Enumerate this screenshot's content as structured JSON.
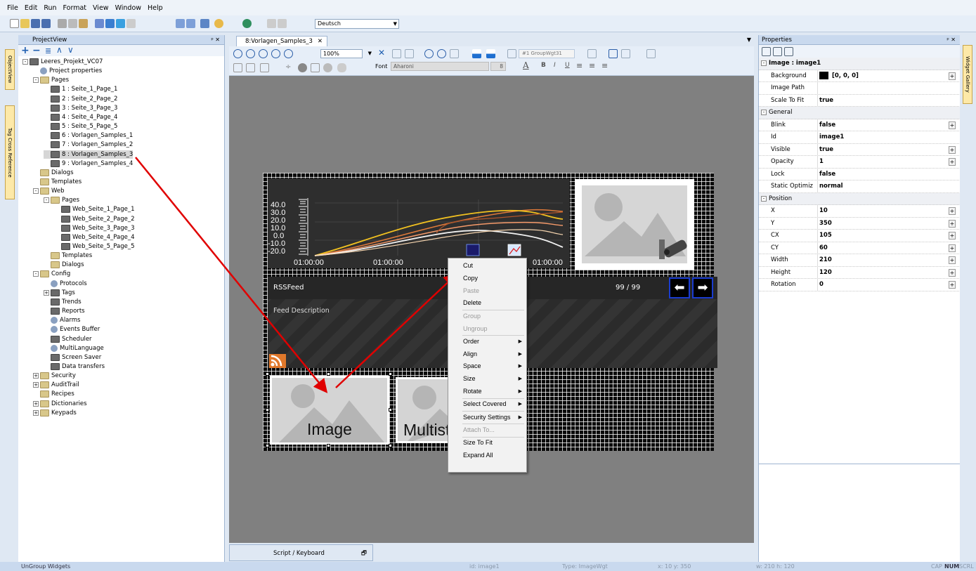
{
  "menu": [
    "File",
    "Edit",
    "Run",
    "Format",
    "View",
    "Window",
    "Help"
  ],
  "toolbar": {
    "language": "Deutsch"
  },
  "project_view": {
    "title": "ProjectView",
    "side_tabs": [
      "ObjectView",
      "Tag Cross Reference"
    ],
    "tree": [
      {
        "label": "Leeres_Projekt_VC07",
        "indent": 0,
        "expander": "-",
        "icon": "project"
      },
      {
        "label": "Project properties",
        "indent": 1,
        "expander": "",
        "icon": "gear"
      },
      {
        "label": "Pages",
        "indent": 1,
        "expander": "-",
        "icon": "folder"
      },
      {
        "label": "1 : Seite_1_Page_1",
        "indent": 2,
        "expander": "",
        "icon": "page"
      },
      {
        "label": "2 : Seite_2_Page_2",
        "indent": 2,
        "expander": "",
        "icon": "page"
      },
      {
        "label": "3 : Seite_3_Page_3",
        "indent": 2,
        "expander": "",
        "icon": "page"
      },
      {
        "label": "4 : Seite_4_Page_4",
        "indent": 2,
        "expander": "",
        "icon": "page"
      },
      {
        "label": "5 : Seite_5_Page_5",
        "indent": 2,
        "expander": "",
        "icon": "page"
      },
      {
        "label": "6 : Vorlagen_Samples_1",
        "indent": 2,
        "expander": "",
        "icon": "page"
      },
      {
        "label": "7 : Vorlagen_Samples_2",
        "indent": 2,
        "expander": "",
        "icon": "page"
      },
      {
        "label": "8 : Vorlagen_Samples_3",
        "indent": 2,
        "expander": "",
        "icon": "page",
        "selected": true
      },
      {
        "label": "9 : Vorlagen_Samples_4",
        "indent": 2,
        "expander": "",
        "icon": "page"
      },
      {
        "label": "Dialogs",
        "indent": 1,
        "expander": "",
        "icon": "folder"
      },
      {
        "label": "Templates",
        "indent": 1,
        "expander": "",
        "icon": "folder"
      },
      {
        "label": "Web",
        "indent": 1,
        "expander": "-",
        "icon": "folder"
      },
      {
        "label": "Pages",
        "indent": 2,
        "expander": "-",
        "icon": "folder"
      },
      {
        "label": "Web_Seite_1_Page_1",
        "indent": 3,
        "expander": "",
        "icon": "page"
      },
      {
        "label": "Web_Seite_2_Page_2",
        "indent": 3,
        "expander": "",
        "icon": "page"
      },
      {
        "label": "Web_Seite_3_Page_3",
        "indent": 3,
        "expander": "",
        "icon": "page"
      },
      {
        "label": "Web_Seite_4_Page_4",
        "indent": 3,
        "expander": "",
        "icon": "page"
      },
      {
        "label": "Web_Seite_5_Page_5",
        "indent": 3,
        "expander": "",
        "icon": "page"
      },
      {
        "label": "Templates",
        "indent": 2,
        "expander": "",
        "icon": "folder"
      },
      {
        "label": "Dialogs",
        "indent": 2,
        "expander": "",
        "icon": "folder"
      },
      {
        "label": "Config",
        "indent": 1,
        "expander": "-",
        "icon": "folder"
      },
      {
        "label": "Protocols",
        "indent": 2,
        "expander": "",
        "icon": "gear"
      },
      {
        "label": "Tags",
        "indent": 2,
        "expander": "+",
        "icon": "page"
      },
      {
        "label": "Trends",
        "indent": 2,
        "expander": "",
        "icon": "page"
      },
      {
        "label": "Reports",
        "indent": 2,
        "expander": "",
        "icon": "page"
      },
      {
        "label": "Alarms",
        "indent": 2,
        "expander": "",
        "icon": "gear"
      },
      {
        "label": "Events Buffer",
        "indent": 2,
        "expander": "",
        "icon": "gear"
      },
      {
        "label": "Scheduler",
        "indent": 2,
        "expander": "",
        "icon": "page"
      },
      {
        "label": "MultiLanguage",
        "indent": 2,
        "expander": "",
        "icon": "gear"
      },
      {
        "label": "Screen Saver",
        "indent": 2,
        "expander": "",
        "icon": "page"
      },
      {
        "label": "Data transfers",
        "indent": 2,
        "expander": "",
        "icon": "page"
      },
      {
        "label": "Security",
        "indent": 1,
        "expander": "+",
        "icon": "folder"
      },
      {
        "label": "AuditTrail",
        "indent": 1,
        "expander": "+",
        "icon": "folder"
      },
      {
        "label": "Recipes",
        "indent": 1,
        "expander": "",
        "icon": "folder"
      },
      {
        "label": "Dictionaries",
        "indent": 1,
        "expander": "+",
        "icon": "folder"
      },
      {
        "label": "Keypads",
        "indent": 1,
        "expander": "+",
        "icon": "folder"
      }
    ]
  },
  "document": {
    "tab_label": "8:Vorlagen_Samples_3",
    "zoom": "100%",
    "group_field": "#1 GroupWgt31",
    "font_label": "Font",
    "font_name": "Aharoni",
    "font_size": "8",
    "script_tab": "Script / Keyboard"
  },
  "canvas": {
    "trend_yticks": [
      "40.0",
      "30.0",
      "20.0",
      "10.0",
      "0.0",
      "-10.0",
      "-20.0"
    ],
    "trend_xticks": [
      "01:00:00",
      "01:00:00",
      "01:00:00"
    ],
    "rss_title": "RSSFeed",
    "rss_count": "99 / 99",
    "rss_description": "Feed Description",
    "image_widget_label": "Image",
    "multistate_label": "Multistate"
  },
  "context_menu": [
    {
      "label": "Cut",
      "disabled": false,
      "submenu": false
    },
    {
      "label": "Copy",
      "disabled": false,
      "submenu": false
    },
    {
      "label": "Paste",
      "disabled": true,
      "submenu": false
    },
    {
      "label": "Delete",
      "disabled": false,
      "submenu": false,
      "sep_after": true
    },
    {
      "label": "Group",
      "disabled": true,
      "submenu": false
    },
    {
      "label": "Ungroup",
      "disabled": true,
      "submenu": false,
      "sep_after": true
    },
    {
      "label": "Order",
      "disabled": false,
      "submenu": true
    },
    {
      "label": "Align",
      "disabled": false,
      "submenu": true
    },
    {
      "label": "Space",
      "disabled": false,
      "submenu": true
    },
    {
      "label": "Size",
      "disabled": false,
      "submenu": true
    },
    {
      "label": "Rotate",
      "disabled": false,
      "submenu": true,
      "sep_after": true
    },
    {
      "label": "Select Covered",
      "disabled": false,
      "submenu": true,
      "sep_after": true
    },
    {
      "label": "Security Settings",
      "disabled": false,
      "submenu": true,
      "sep_after": true
    },
    {
      "label": "Attach To...",
      "disabled": true,
      "submenu": false,
      "sep_after": true
    },
    {
      "label": "Size To Fit",
      "disabled": false,
      "submenu": false
    },
    {
      "label": "Expand All",
      "disabled": false,
      "submenu": false
    }
  ],
  "properties": {
    "title": "Properties",
    "side_tab": "Widget Gallery",
    "rows": [
      {
        "kind": "cat",
        "label": "Image : image1"
      },
      {
        "kind": "prop",
        "name": "Background",
        "value": "[0, 0, 0]",
        "swatch": "#000000",
        "plus": true
      },
      {
        "kind": "prop",
        "name": "Image Path",
        "value": "",
        "plus": false
      },
      {
        "kind": "prop",
        "name": "Scale To Fit",
        "value": "true",
        "plus": false
      },
      {
        "kind": "cat",
        "label": "General"
      },
      {
        "kind": "prop",
        "name": "Blink",
        "value": "false",
        "plus": true
      },
      {
        "kind": "prop",
        "name": "Id",
        "value": "image1",
        "plus": false
      },
      {
        "kind": "prop",
        "name": "Visible",
        "value": "true",
        "plus": true
      },
      {
        "kind": "prop",
        "name": "Opacity",
        "value": "1",
        "plus": true
      },
      {
        "kind": "prop",
        "name": "Lock",
        "value": "false",
        "plus": false
      },
      {
        "kind": "prop",
        "name": "Static Optimiz",
        "value": "normal",
        "plus": false
      },
      {
        "kind": "cat",
        "label": "Position"
      },
      {
        "kind": "prop",
        "name": "X",
        "value": "10",
        "plus": true
      },
      {
        "kind": "prop",
        "name": "Y",
        "value": "350",
        "plus": true
      },
      {
        "kind": "prop",
        "name": "CX",
        "value": "105",
        "plus": true
      },
      {
        "kind": "prop",
        "name": "CY",
        "value": "60",
        "plus": true
      },
      {
        "kind": "prop",
        "name": "Width",
        "value": "210",
        "plus": true
      },
      {
        "kind": "prop",
        "name": "Height",
        "value": "120",
        "plus": true
      },
      {
        "kind": "prop",
        "name": "Rotation",
        "value": "0",
        "plus": true
      }
    ]
  },
  "status": {
    "left": "UnGroup Widgets",
    "id": "id: image1",
    "type": "Type: ImageWgt",
    "xy": "x: 10    y: 350",
    "wh": "w: 210    h: 120",
    "keys": [
      "CAP",
      "NUM",
      "SCRL"
    ]
  }
}
